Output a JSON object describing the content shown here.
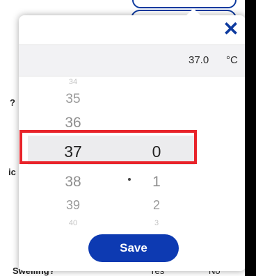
{
  "background": {
    "fragments": [
      {
        "text": "?"
      },
      {
        "text": "ic"
      },
      {
        "text": "Swelling?"
      },
      {
        "text": "Yes"
      },
      {
        "text": "No"
      }
    ]
  },
  "picker": {
    "close_icon": "close-icon",
    "value": "37.0",
    "unit": "°C",
    "integer_options": [
      "34",
      "35",
      "36",
      "37",
      "38",
      "39",
      "40"
    ],
    "decimal_options": [
      "0",
      "1",
      "2",
      "3"
    ],
    "selected_integer": "37",
    "selected_decimal": "0",
    "save_label": "Save"
  },
  "colors": {
    "accent": "#0d3ab2",
    "highlight": "#e8232a"
  }
}
